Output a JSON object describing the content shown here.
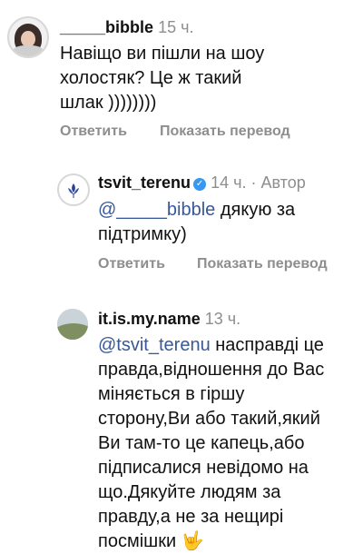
{
  "comments": [
    {
      "username": "_____bibble",
      "time": "15 ч.",
      "text_lines": [
        "Навіщо ви пішли на шоу",
        "холостяк? Це ж такий",
        "шлак ))))))))"
      ],
      "reply_label": "Ответить",
      "translate_label": "Показать перевод"
    },
    {
      "username": "tsvit_terenu",
      "time": "14 ч.",
      "author_tag": "· Автор",
      "mention": "@_____bibble",
      "text_first_rest": " дякую за",
      "text_lines": [
        "підтримку)"
      ],
      "reply_label": "Ответить",
      "translate_label": "Показать перевод"
    },
    {
      "username": "it.is.my.name",
      "time": "13 ч.",
      "mention": "@tsvit_terenu",
      "text_first_rest": " насправді це",
      "text_lines": [
        "правда,відношення до Вас",
        "міняється в гіршу",
        "сторону,Ви або такий,який",
        "Ви там-то це капець,або",
        "підписалися невідомо на",
        "що.Дякуйте людям за",
        "правду,а не за нещирі",
        "посмішки 🤟"
      ]
    }
  ],
  "colors": {
    "mention": "#385898",
    "meta": "#8e8e8e",
    "verified": "#3897f0"
  }
}
